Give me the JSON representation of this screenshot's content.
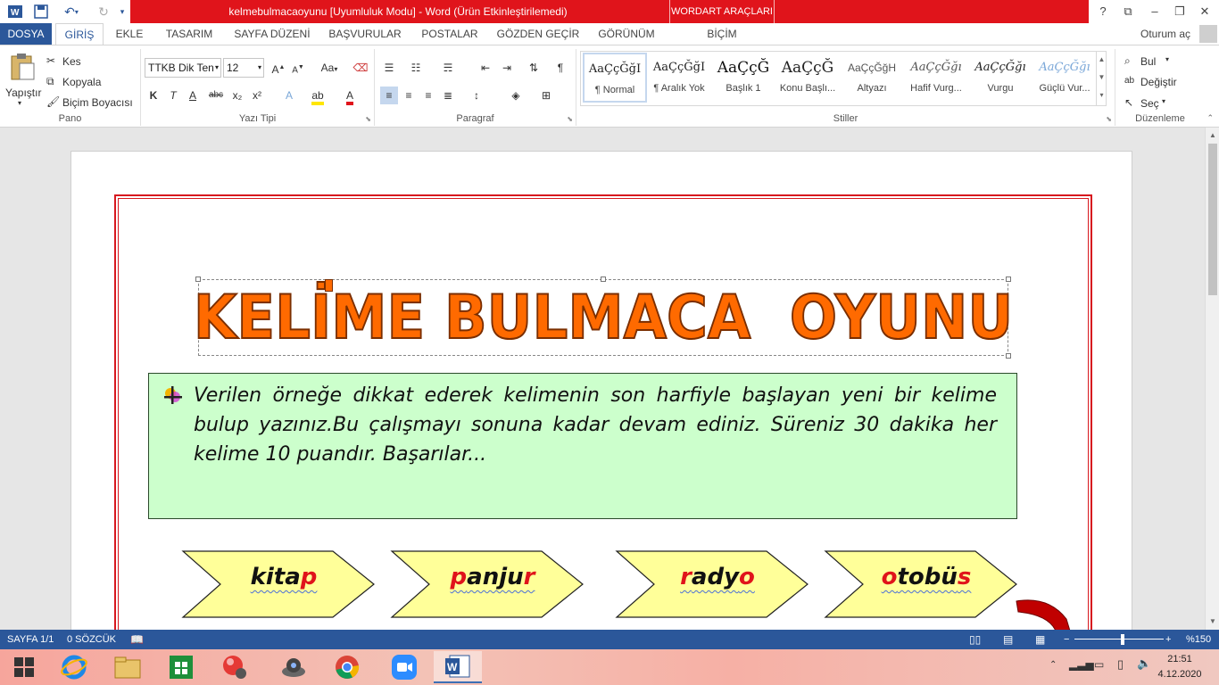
{
  "window": {
    "title": "kelmebulmacaoyunu [Uyumluluk Modu] - Word (Ürün Etkinleştirilemedi)",
    "contextual_tab_group": "WORDART ARAÇLARI",
    "controls": [
      "?",
      "⧉",
      "–",
      "❐",
      "✕"
    ]
  },
  "tabs": [
    {
      "label": "DOSYA"
    },
    {
      "label": "GİRİŞ"
    },
    {
      "label": "EKLE"
    },
    {
      "label": "TASARIM"
    },
    {
      "label": "SAYFA DÜZENİ"
    },
    {
      "label": "BAŞVURULAR"
    },
    {
      "label": "POSTALAR"
    },
    {
      "label": "GÖZDEN GEÇİR"
    },
    {
      "label": "GÖRÜNÜM"
    },
    {
      "label": "BİÇİM"
    }
  ],
  "signin": "Oturum aç",
  "ribbon": {
    "clipboard": {
      "paste": "Yapıştır",
      "cut": "Kes",
      "copy": "Kopyala",
      "format_painter": "Biçim Boyacısı",
      "label": "Pano"
    },
    "font": {
      "name": "TTKB Dik Ten",
      "size": "12",
      "label": "Yazı Tipi",
      "bold": "K",
      "italic": "T",
      "underline": "A",
      "strike": "abc",
      "sub": "x₂",
      "sup": "x²",
      "case": "Aa"
    },
    "paragraph": {
      "label": "Paragraf",
      "pilcrow": "¶"
    },
    "styles": {
      "label": "Stiller",
      "items": [
        {
          "preview": "AaÇçĞğI",
          "name": "¶ Normal"
        },
        {
          "preview": "AaÇçĞğI",
          "name": "¶ Aralık Yok"
        },
        {
          "preview": "AaÇçĞ",
          "name": "Başlık 1"
        },
        {
          "preview": "AaÇçĞ",
          "name": "Konu Başlı..."
        },
        {
          "preview": "AaÇçĞğH",
          "name": "Altyazı"
        },
        {
          "preview": "AaÇçĞğı",
          "name": "Hafif Vurg..."
        },
        {
          "preview": "AaÇçĞğı",
          "name": "Vurgu"
        },
        {
          "preview": "AaÇçĞğı",
          "name": "Güçlü Vur..."
        }
      ]
    },
    "editing": {
      "label": "Düzenleme",
      "find": "Bul",
      "replace": "Değiştir",
      "select": "Seç"
    }
  },
  "document": {
    "wordart": "KELİME BULMACA  OYUNU",
    "instruction": "Verilen örneğe dikkat ederek kelimenin son harfiyle başlayan yeni bir kelime bulup yazınız.Bu çalışmayı sonuna kadar devam ediniz. Süreniz 30 dakika her kelime 10 puandır. Başarılar...",
    "words": [
      {
        "pre": "kita",
        "end": "p",
        "start": ""
      },
      {
        "start": "p",
        "mid": "anju",
        "end": "r"
      },
      {
        "start": "r",
        "mid": "ady",
        "end": "o"
      },
      {
        "start": "o",
        "mid": "tobü",
        "end": "s"
      }
    ],
    "colors": {
      "wordart_fill": "#ff6a00",
      "border": "#d7191f",
      "instruction_bg": "#ccffcc",
      "arrow_fill": "#ffff99",
      "highlight_letter": "#e0141b"
    }
  },
  "statusbar": {
    "page": "SAYFA 1/1",
    "words": "0 SÖZCÜK",
    "zoom": "%150"
  },
  "taskbar": {
    "time": "21:51",
    "date": "4.12.2020",
    "apps": [
      "start",
      "internet-explorer",
      "file-explorer",
      "store",
      "app-red-ball",
      "camera-app",
      "chrome",
      "zoom",
      "word"
    ]
  }
}
